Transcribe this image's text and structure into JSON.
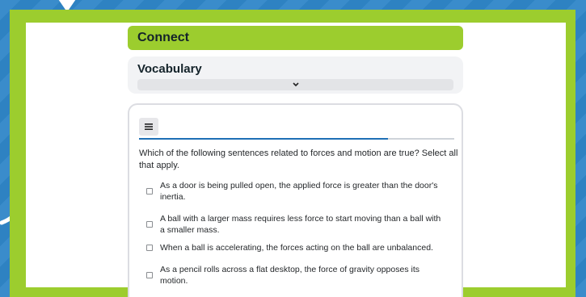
{
  "app": {
    "section_title": "Connect"
  },
  "vocabulary": {
    "title": "Vocabulary",
    "toggle_icon": "chevron-down-icon"
  },
  "toolbar": {
    "menu_icon": "hamburger-menu-icon"
  },
  "progress": {
    "fraction": 0.79,
    "fill_color": "#1e6fb5"
  },
  "question": {
    "prompt": "Which of the following sentences related to forces and motion are true? Select all that apply.",
    "options": [
      {
        "label": "As a door is being pulled open, the applied force is greater than the door's inertia."
      },
      {
        "label": "A ball with a larger mass requires less force to start moving than a ball with a smaller mass."
      },
      {
        "label": "When a ball is accelerating, the forces acting on the ball are unbalanced."
      },
      {
        "label": "As a pencil rolls across a flat desktop, the force of gravity opposes its motion."
      }
    ]
  },
  "colors": {
    "accent_green": "#9ccd2e",
    "background_blue": "#2f86c8",
    "progress_blue": "#1e6fb5"
  }
}
